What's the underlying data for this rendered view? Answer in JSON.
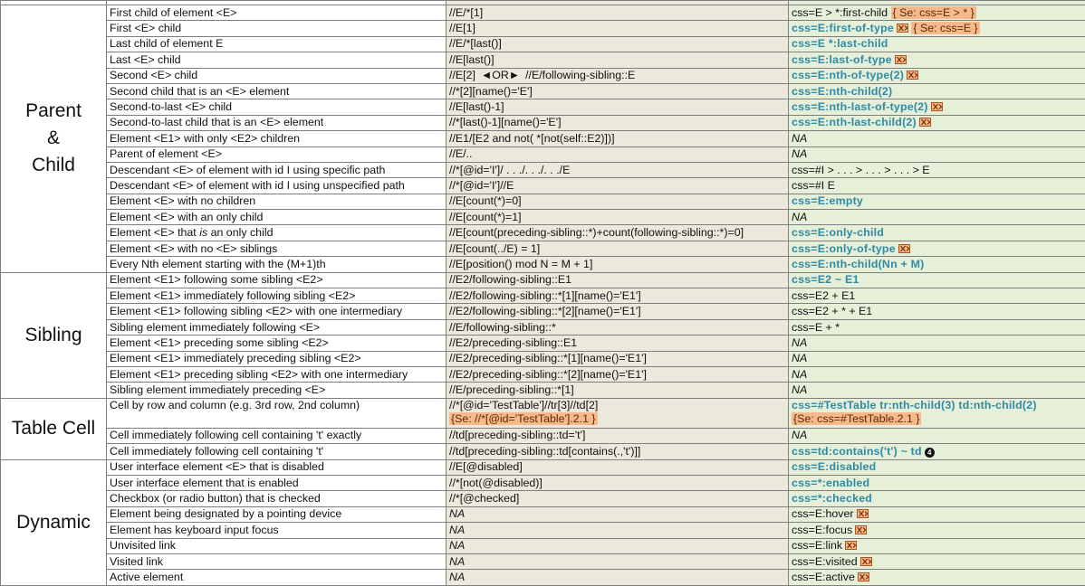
{
  "colors": {
    "xpath_bg": "#ebe8dc",
    "css_bg": "#e6efd8",
    "css_accent": "#2f8aa6",
    "se_bg": "#f5b98a",
    "border": "#7f7f7f"
  },
  "categories": {
    "parent_child": "Parent\n&\nChild",
    "sibling": "Sibling",
    "table_cell": "Table Cell",
    "dynamic": "Dynamic"
  },
  "rows": [
    {
      "desc": "First child of element <E>",
      "xpath": "//E/*[1]",
      "css": "css=E > *:first-child",
      "se": "{ Se: css=E > * }"
    },
    {
      "desc": "First <E> child",
      "xpath": "//E[1]",
      "css": "css=E:first-of-type",
      "se": "{ Se: css=E }"
    },
    {
      "desc": "Last child of element E",
      "xpath": "//E/*[last()]",
      "css": "css=E *:last-child"
    },
    {
      "desc": "Last <E> child",
      "xpath": "//E[last()]",
      "css": "css=E:last-of-type"
    },
    {
      "desc": "Second <E> child",
      "xpath": "//E[2]",
      "or": "◄OR►",
      "xpath2": "//E/following-sibling::E",
      "css": "css=E:nth-of-type(2)"
    },
    {
      "desc": "Second child that is an <E> element",
      "xpath": "//*[2][name()='E']",
      "css": "css=E:nth-child(2)"
    },
    {
      "desc": "Second-to-last <E> child",
      "xpath": "//E[last()-1]",
      "css": "css=E:nth-last-of-type(2)"
    },
    {
      "desc": "Second-to-last child that is an <E> element",
      "xpath": "//*[last()-1][name()='E']",
      "css": "css=E:nth-last-child(2)"
    },
    {
      "desc": "Element <E1> with only <E2> children",
      "xpath": "//E1/[E2 and not( *[not(self::E2)])]",
      "css": "NA"
    },
    {
      "desc": "Parent of element <E>",
      "xpath": "//E/..",
      "css": "NA"
    },
    {
      "desc": "Descendant <E> of element with id I using specific path",
      "xpath": "//*[@id='I']/ . . ./. . ./. . ./E",
      "css": "css=#I > . . . > . . . > . . . > E"
    },
    {
      "desc": "Descendant <E> of element with id I using unspecified path",
      "xpath": "//*[@id='I']//E",
      "css": "css=#I  E"
    },
    {
      "desc": "Element <E> with no children",
      "xpath": "//E[count(*)=0]",
      "css": "css=E:empty"
    },
    {
      "desc": "Element <E> with an only child",
      "xpath": "//E[count(*)=1]",
      "css": "NA"
    },
    {
      "desc": "Element <E> that is an only child",
      "desc_pre": "Element <E> that ",
      "desc_em": "is",
      "desc_post": " an only child",
      "xpath": "//E[count(preceding-sibling::*)+count(following-sibling::*)=0]",
      "css": "css=E:only-child"
    },
    {
      "desc": "Element <E> with no <E> siblings",
      "xpath": "//E[count(../E) = 1]",
      "css": "css=E:only-of-type"
    },
    {
      "desc": "Every Nth element starting with the (M+1)th",
      "xpath": "//E[position() mod N = M + 1]",
      "css": "css=E:nth-child(Nn + M)"
    },
    {
      "desc": "Element <E1> following some sibling <E2>",
      "xpath": "//E2/following-sibling::E1",
      "css": "css=E2 ~ E1"
    },
    {
      "desc": "Element <E1> immediately following sibling <E2>",
      "xpath": "//E2/following-sibling::*[1][name()='E1']",
      "css": "css=E2 + E1"
    },
    {
      "desc": "Element <E1> following sibling <E2> with one intermediary",
      "xpath": "//E2/following-sibling::*[2][name()='E1']",
      "css": "css=E2 + * + E1"
    },
    {
      "desc": "Sibling element immediately following <E>",
      "xpath": "//E/following-sibling::*",
      "css": "css=E + *"
    },
    {
      "desc": "Element <E1> preceding some  sibling <E2>",
      "xpath": "//E2/preceding-sibling::E1",
      "css": "NA"
    },
    {
      "desc": "Element <E1> immediately preceding sibling <E2>",
      "xpath": "//E2/preceding-sibling::*[1][name()='E1']",
      "css": "NA"
    },
    {
      "desc": "Element <E1> preceding sibling <E2> with one intermediary",
      "xpath": "//E2/preceding-sibling::*[2][name()='E1']",
      "css": "NA"
    },
    {
      "desc": "Sibling element immediately preceding <E>",
      "xpath": "//E/preceding-sibling::*[1]",
      "css": "NA"
    },
    {
      "desc": "Cell by row and column (e.g. 3rd row, 2nd column)",
      "xpath": "//*[@id='TestTable']//tr[3]//td[2]",
      "xpath_se": "{Se: //*[@id='TestTable'].2.1 }",
      "css": "css=#TestTable tr:nth-child(3) td:nth-child(2)",
      "css_se": "{Se: css=#TestTable.2.1 }"
    },
    {
      "desc": "Cell immediately following cell containing 't' exactly",
      "xpath": "//td[preceding-sibling::td='t']",
      "css": "NA"
    },
    {
      "desc": "Cell immediately following cell containing 't'",
      "xpath": "//td[preceding-sibling::td[contains(.,'t')]]",
      "css": "css=td:contains('t') ~ td",
      "badge": "4"
    },
    {
      "desc": "User interface element <E> that is disabled",
      "xpath": "//E[@disabled]",
      "css": "css=E:disabled"
    },
    {
      "desc": "User interface element that is enabled",
      "xpath": "//*[not(@disabled)]",
      "css": "css=*:enabled"
    },
    {
      "desc": "Checkbox (or radio button) that is checked",
      "xpath": "//*[@checked]",
      "css": "css=*:checked"
    },
    {
      "desc": "Element being designated by a pointing device",
      "xpath": "NA",
      "css": "css=E:hover"
    },
    {
      "desc": "Element has keyboard input focus",
      "xpath": "NA",
      "css": "css=E:focus"
    },
    {
      "desc": "Unvisited link",
      "xpath": "NA",
      "css": "css=E:link"
    },
    {
      "desc": "Visited link",
      "xpath": "NA",
      "css": "css=E:visited"
    },
    {
      "desc": "Active element",
      "xpath": "NA",
      "css": "css=E:active"
    }
  ]
}
